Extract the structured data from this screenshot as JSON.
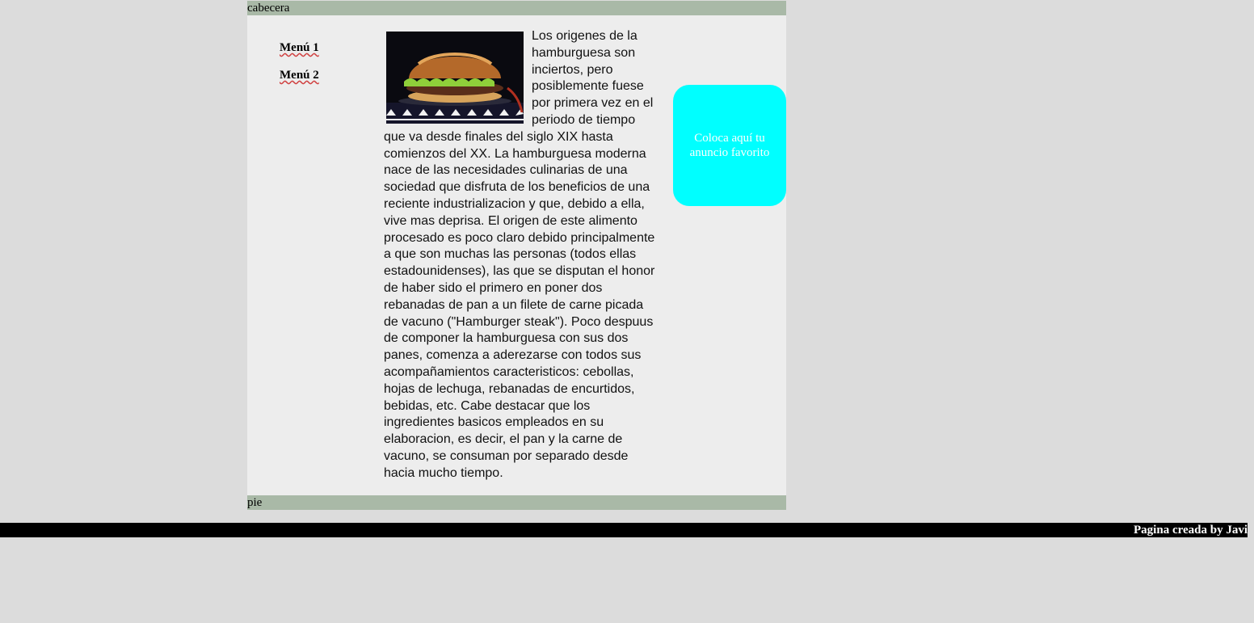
{
  "header": {
    "label": "cabecera"
  },
  "menu": {
    "items": [
      {
        "label": "Menú 1"
      },
      {
        "label": "Menú 2"
      }
    ]
  },
  "article": {
    "text": "Los origenes de la hamburguesa son inciertos, pero posiblemente fuese por primera vez en el periodo de tiempo que va desde finales del siglo XIX hasta comienzos del XX. La hamburguesa moderna nace de las necesidades culinarias de una sociedad que disfruta de los beneficios de una reciente industrializacion y que, debido a ella, vive mas deprisa. El origen de este alimento procesado es poco claro debido principalmente a que son muchas las personas (todos ellas estadounidenses), las que se disputan el honor de haber sido el primero en poner dos rebanadas de pan a un filete de carne picada de vacuno (\"Hamburger steak\"). Poco despuus de componer la hamburguesa con sus dos panes, comenza a aderezarse con todos sus acompañamientos caracteristicos: cebollas, hojas de lechuga, rebanadas de encurtidos, bebidas, etc. Cabe destacar que los ingredientes basicos empleados en su elaboracion, es decir, el pan y la carne de vacuno, se consuman por separado desde hacia mucho tiempo."
  },
  "ad": {
    "text": "Coloca aquí tu anuncio favorito",
    "color": "#00ffff"
  },
  "footer": {
    "label": "pie"
  },
  "credit": {
    "text": "Pagina creada by Javi"
  },
  "colors": {
    "bar": "#a9b9a7",
    "content": "#ededed",
    "background": "#dcdcdc"
  }
}
